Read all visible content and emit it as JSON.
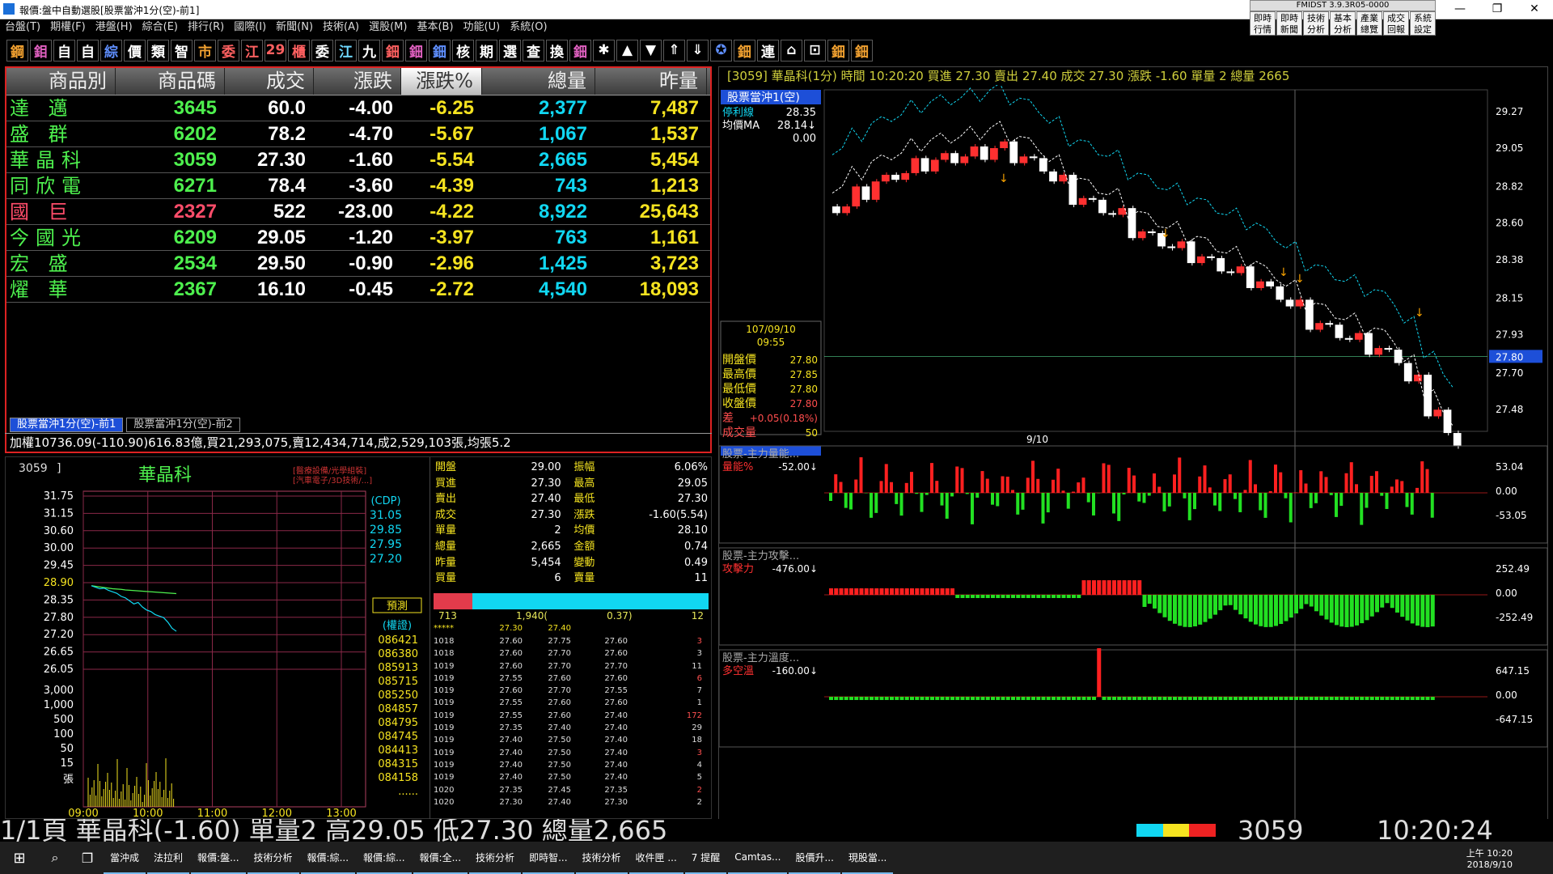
{
  "window": {
    "title": "報價:盤中自動選股[股票當沖1分(空)-前1]",
    "fmid": "FMIDST 3.9.3R05-0000",
    "controls": [
      "—",
      "❐",
      "✕"
    ]
  },
  "menu": [
    "台盤(T)",
    "期權(F)",
    "港盤(H)",
    "綜合(E)",
    "排行(R)",
    "國際(I)",
    "新聞(N)",
    "技術(A)",
    "選股(M)",
    "基本(B)",
    "功能(U)",
    "系統(O)"
  ],
  "quick_buttons": [
    "即時行情",
    "即時新聞",
    "技術分析",
    "基本分析",
    "產業總覽",
    "成交回報",
    "系統設定"
  ],
  "toolbar": [
    {
      "label": "鋼",
      "color": "#f0a030"
    },
    {
      "label": "鉬",
      "color": "#e060c0"
    },
    {
      "label": "自",
      "color": "#fff"
    },
    {
      "label": "自",
      "color": "#fff"
    },
    {
      "label": "綜",
      "color": "#5f8fff"
    },
    {
      "label": "價",
      "color": "#fff"
    },
    {
      "label": "類",
      "color": "#fff"
    },
    {
      "label": "智",
      "color": "#fff"
    },
    {
      "label": "市",
      "color": "#f0a030"
    },
    {
      "label": "委",
      "color": "#ff6060"
    },
    {
      "label": "江",
      "color": "#ff6060"
    },
    {
      "label": "29",
      "color": "#ff6060"
    },
    {
      "label": "櫃",
      "color": "#ff6060"
    },
    {
      "label": "委",
      "color": "#fff"
    },
    {
      "label": "江",
      "color": "#6fd8ff"
    },
    {
      "label": "九",
      "color": "#fff"
    },
    {
      "label": "鈿",
      "color": "#ff6060"
    },
    {
      "label": "鈿",
      "color": "#e060c0"
    },
    {
      "label": "鈿",
      "color": "#5f8fff"
    },
    {
      "label": "核",
      "color": "#fff"
    },
    {
      "label": "期",
      "color": "#fff"
    },
    {
      "label": "選",
      "color": "#fff"
    },
    {
      "label": "查",
      "color": "#fff"
    },
    {
      "label": "換",
      "color": "#fff"
    },
    {
      "label": "鈿",
      "color": "#e060c0"
    },
    {
      "label": "✱",
      "color": "#fff"
    },
    {
      "label": "▲",
      "color": "#fff"
    },
    {
      "label": "▼",
      "color": "#fff"
    },
    {
      "label": "⇑",
      "color": "#fff"
    },
    {
      "label": "⇓",
      "color": "#fff"
    },
    {
      "label": "✪",
      "color": "#5f8fff"
    },
    {
      "label": "鈿",
      "color": "#f0a030"
    },
    {
      "label": "連",
      "color": "#fff"
    },
    {
      "label": "⌂",
      "color": "#fff"
    },
    {
      "label": "⊡",
      "color": "#fff"
    },
    {
      "label": "鈿",
      "color": "#f0a030"
    },
    {
      "label": "鈿",
      "color": "#f0a030"
    }
  ],
  "ranklist": {
    "headers": [
      "商品別",
      "商品碼",
      "成交",
      "漲跌",
      "漲跌%",
      "總量",
      "昨量"
    ],
    "rows": [
      {
        "name": "達 邁",
        "code": "3645",
        "price": "60.0",
        "chg": "-4.00",
        "pct": "-6.25",
        "vol": "2,377",
        "yvol": "7,487"
      },
      {
        "name": "盛 群",
        "code": "6202",
        "price": "78.2",
        "chg": "-4.70",
        "pct": "-5.67",
        "vol": "1,067",
        "yvol": "1,537"
      },
      {
        "name": "華晶科",
        "code": "3059",
        "price": "27.30",
        "chg": "-1.60",
        "pct": "-5.54",
        "vol": "2,665",
        "yvol": "5,454"
      },
      {
        "name": "同欣電",
        "code": "6271",
        "price": "78.4",
        "chg": "-3.60",
        "pct": "-4.39",
        "vol": "743",
        "yvol": "1,213"
      },
      {
        "name": "國 巨",
        "code": "2327",
        "price": "522",
        "chg": "-23.00",
        "pct": "-4.22",
        "vol": "8,922",
        "yvol": "25,643",
        "highlight": true
      },
      {
        "name": "今國光",
        "code": "6209",
        "price": "29.05",
        "chg": "-1.20",
        "pct": "-3.97",
        "vol": "763",
        "yvol": "1,161"
      },
      {
        "name": "宏 盛",
        "code": "2534",
        "price": "29.50",
        "chg": "-0.90",
        "pct": "-2.96",
        "vol": "1,425",
        "yvol": "3,723"
      },
      {
        "name": "燿 華",
        "code": "2367",
        "price": "16.10",
        "chg": "-0.45",
        "pct": "-2.72",
        "vol": "4,540",
        "yvol": "18,093"
      }
    ],
    "tabs": [
      "股票當沖1分(空)-前1",
      "股票當沖1分(空)-前2"
    ],
    "index_line": "加權10736.09(-110.90)616.83億,買21,293,075,賣12,434,714,成2,529,103張,均張5.2"
  },
  "quote": {
    "code": "3059",
    "name": "華晶科",
    "category": "[醫療設備/光學組裝]",
    "category2": "[汽車電子/3D技術/...]",
    "price_axis": [
      "31.75",
      "31.15",
      "30.60",
      "30.00",
      "29.45",
      "28.90",
      "28.35",
      "27.80",
      "27.20",
      "26.65",
      "26.05"
    ],
    "vol_axis": [
      "3,000",
      "1,000",
      "500",
      "100",
      "50",
      "15"
    ],
    "vol_unit": "張",
    "time_axis": [
      "09:00",
      "10:00",
      "11:00",
      "12:00",
      "13:00"
    ],
    "cdp_label": "(CDP)",
    "cdp": [
      "31.05",
      "29.85",
      "27.95",
      "27.20"
    ],
    "predict_label": "預測",
    "warrant_label": "(權證)",
    "warrants": [
      "086421",
      "086380",
      "085913",
      "085715",
      "085250",
      "084857",
      "084795",
      "084745",
      "084413",
      "084315",
      "084158",
      "......"
    ],
    "intraday_prices": [
      28.8,
      28.75,
      28.7,
      28.72,
      28.65,
      28.6,
      28.55,
      28.45,
      28.4,
      28.3,
      28.2,
      28.25,
      28.1,
      28.0,
      27.95,
      27.85,
      27.8,
      27.75,
      27.6,
      27.4,
      27.3
    ],
    "intraday_avg": [
      28.8,
      28.78,
      28.76,
      28.74,
      28.72,
      28.7,
      28.69,
      28.68,
      28.66,
      28.65,
      28.64,
      28.63,
      28.62,
      28.61,
      28.6,
      28.59,
      28.58,
      28.57,
      28.56,
      28.55,
      28.54
    ],
    "fields": [
      {
        "l": "開盤",
        "v": "29.00",
        "l2": "振幅",
        "v2": "6.06%"
      },
      {
        "l": "買進",
        "v": "27.30",
        "l2": "最高",
        "v2": "29.05"
      },
      {
        "l": "賣出",
        "v": "27.40",
        "l2": "最低",
        "v2": "27.30"
      },
      {
        "l": "成交",
        "v": "27.30",
        "l2": "漲跌",
        "v2": "-1.60(5.54)"
      },
      {
        "l": "單量",
        "v": "2",
        "l2": "均價",
        "v2": "28.10"
      },
      {
        "l": "總量",
        "v": "2,665",
        "l2": "金額",
        "v2": "0.74"
      },
      {
        "l": "昨量",
        "v": "5,454",
        "l2": "變動",
        "v2": "0.49"
      },
      {
        "l": "買量",
        "v": "6",
        "l2": "賣量",
        "v2": "11"
      }
    ],
    "depth": {
      "left": "713",
      "mid": "1,940(",
      "mid2": "0.37)",
      "right": "12"
    },
    "ticks_header": [
      "*****",
      "27.30",
      "27.40"
    ],
    "ticks": [
      [
        "1018",
        "27.60",
        "27.75",
        "27.60",
        "3"
      ],
      [
        "1018",
        "27.60",
        "27.70",
        "27.60",
        "3"
      ],
      [
        "1019",
        "27.60",
        "27.70",
        "27.70",
        "11"
      ],
      [
        "1019",
        "27.55",
        "27.60",
        "27.60",
        "6"
      ],
      [
        "1019",
        "27.60",
        "27.70",
        "27.55",
        "7"
      ],
      [
        "1019",
        "27.55",
        "27.60",
        "27.60",
        "1"
      ],
      [
        "1019",
        "27.55",
        "27.60",
        "27.40",
        "172"
      ],
      [
        "1019",
        "27.35",
        "27.40",
        "27.40",
        "29"
      ],
      [
        "1019",
        "27.40",
        "27.50",
        "27.40",
        "18"
      ],
      [
        "1019",
        "27.40",
        "27.50",
        "27.40",
        "3"
      ],
      [
        "1019",
        "27.40",
        "27.50",
        "27.40",
        "4"
      ],
      [
        "1019",
        "27.40",
        "27.50",
        "27.40",
        "5"
      ],
      [
        "1020",
        "27.35",
        "27.45",
        "27.35",
        "2"
      ],
      [
        "1020",
        "27.30",
        "27.40",
        "27.30",
        "2"
      ]
    ]
  },
  "chart": {
    "info": "[3059] 華晶科(1分) 時間 10:20:20  買進 27.30   賣出 27.40   成交 27.30  漲跌 -1.60  單量 2    總量 2665",
    "panel_tag": "股票當沖1(空)",
    "legend": [
      {
        "l": "停利線",
        "v": "28.35"
      },
      {
        "l": "均價MA",
        "v": "28.14↓"
      },
      {
        "l": "",
        "v": "0.00"
      }
    ],
    "date": "107/09/10",
    "time": "09:55",
    "ohlc": [
      {
        "l": "開盤價",
        "v": "27.80"
      },
      {
        "l": "最高價",
        "v": "27.85"
      },
      {
        "l": "最低價",
        "v": "27.80"
      },
      {
        "l": "收盤價",
        "v": "27.80"
      },
      {
        "l": "差",
        "v": "+0.05(0.18%)"
      },
      {
        "l": "成交量",
        "v": "50"
      }
    ],
    "y_axis": [
      "29.27",
      "29.05",
      "28.82",
      "28.60",
      "28.38",
      "28.15",
      "27.93",
      "27.80",
      "27.70",
      "27.48"
    ],
    "current_price_tag": "27.80",
    "x_label": "9/10",
    "sub1": {
      "title": "股票-主力量能...",
      "ind": "量能%",
      "val": "-52.00↓",
      "axis": [
        "53.04",
        "0.00",
        "-53.05"
      ]
    },
    "sub2": {
      "title": "股票-主力攻擊...",
      "ind": "攻擊力",
      "val": "-476.00↓",
      "axis": [
        "252.49",
        "0.00",
        "-252.49"
      ]
    },
    "sub3": {
      "title": "股票-主力溫度...",
      "ind": "多空溫",
      "val": "-160.00↓",
      "axis": [
        "647.15",
        "0.00",
        "-647.15"
      ]
    },
    "chart_data": {
      "type": "candlestick",
      "series": [
        {
          "name": "股票當沖1(空)"
        }
      ],
      "close_sample": [
        28.7,
        28.78,
        28.85,
        28.9,
        28.95,
        28.98,
        29.0,
        29.02,
        29.05,
        29.0,
        28.95,
        28.85,
        28.75,
        28.7,
        28.65,
        28.55,
        28.5,
        28.45,
        28.4,
        28.35,
        28.3,
        28.25,
        28.18,
        28.1,
        28.0,
        27.95,
        27.9,
        27.85,
        27.8,
        27.65,
        27.48,
        27.3
      ]
    }
  },
  "ticker": "1/1頁  華晶科(-1.60) 單量2  高29.05  低27.30  總量2,665",
  "ticker_code": "3059",
  "ticker_time": "10:20:24",
  "taskbar": {
    "items": [
      "當沖成",
      "法拉利",
      "報價:盤...",
      "技術分析",
      "報價:綜...",
      "報價:綜...",
      "報價:全...",
      "技術分析",
      "即時智...",
      "技術分析",
      "收件匣 ...",
      "7 提醒",
      "Camtas...",
      "股價升...",
      "現股當..."
    ],
    "time": "上午 10:20",
    "date": "2018/9/10"
  }
}
